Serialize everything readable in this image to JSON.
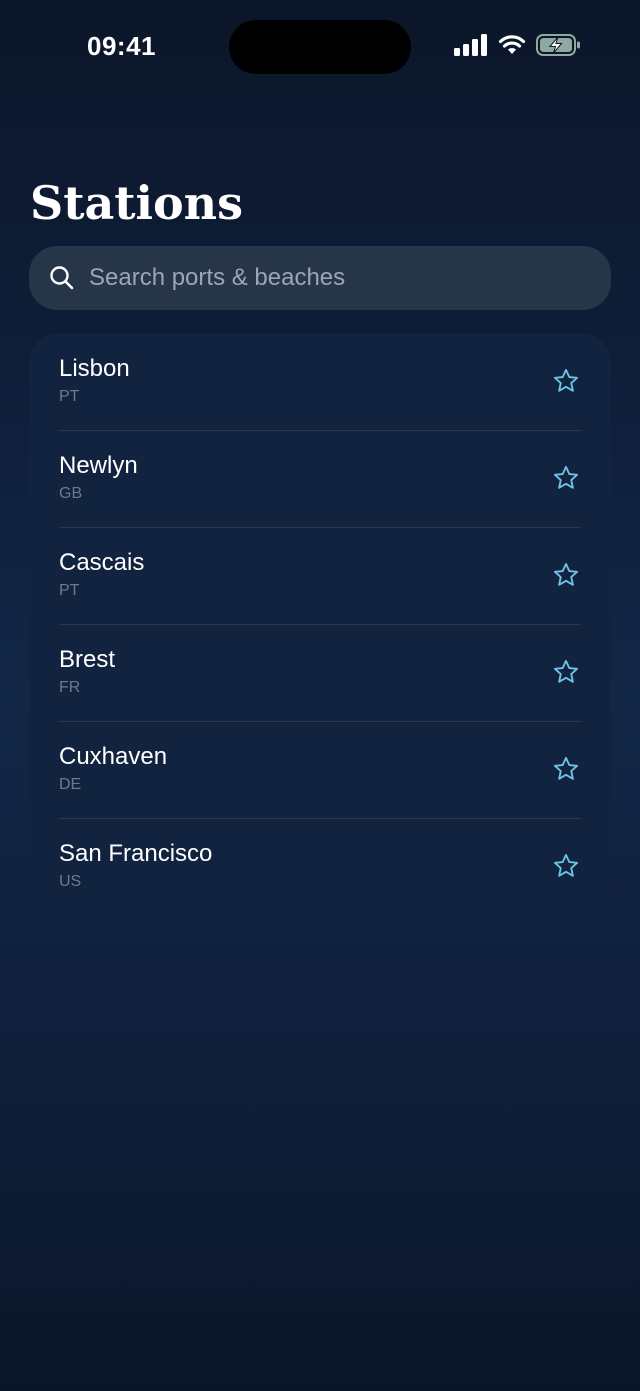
{
  "status_bar": {
    "time": "09:41"
  },
  "header": {
    "title": "Stations"
  },
  "search": {
    "placeholder": "Search ports & beaches",
    "value": ""
  },
  "stations": [
    {
      "name": "Lisbon",
      "country": "PT"
    },
    {
      "name": "Newlyn",
      "country": "GB"
    },
    {
      "name": "Cascais",
      "country": "PT"
    },
    {
      "name": "Brest",
      "country": "FR"
    },
    {
      "name": "Cuxhaven",
      "country": "DE"
    },
    {
      "name": "San Francisco",
      "country": "US"
    }
  ],
  "icons": {
    "search": "search-icon",
    "favorite": "star-outline-icon",
    "signal": "cellular-signal-icon",
    "wifi": "wifi-icon",
    "battery": "battery-charging-icon"
  },
  "colors": {
    "background": "#0f1f3b",
    "card": "#12233f",
    "search_field": "#273549",
    "accent_star": "#6ec3e6",
    "secondary_text": "#6d7a8e"
  }
}
